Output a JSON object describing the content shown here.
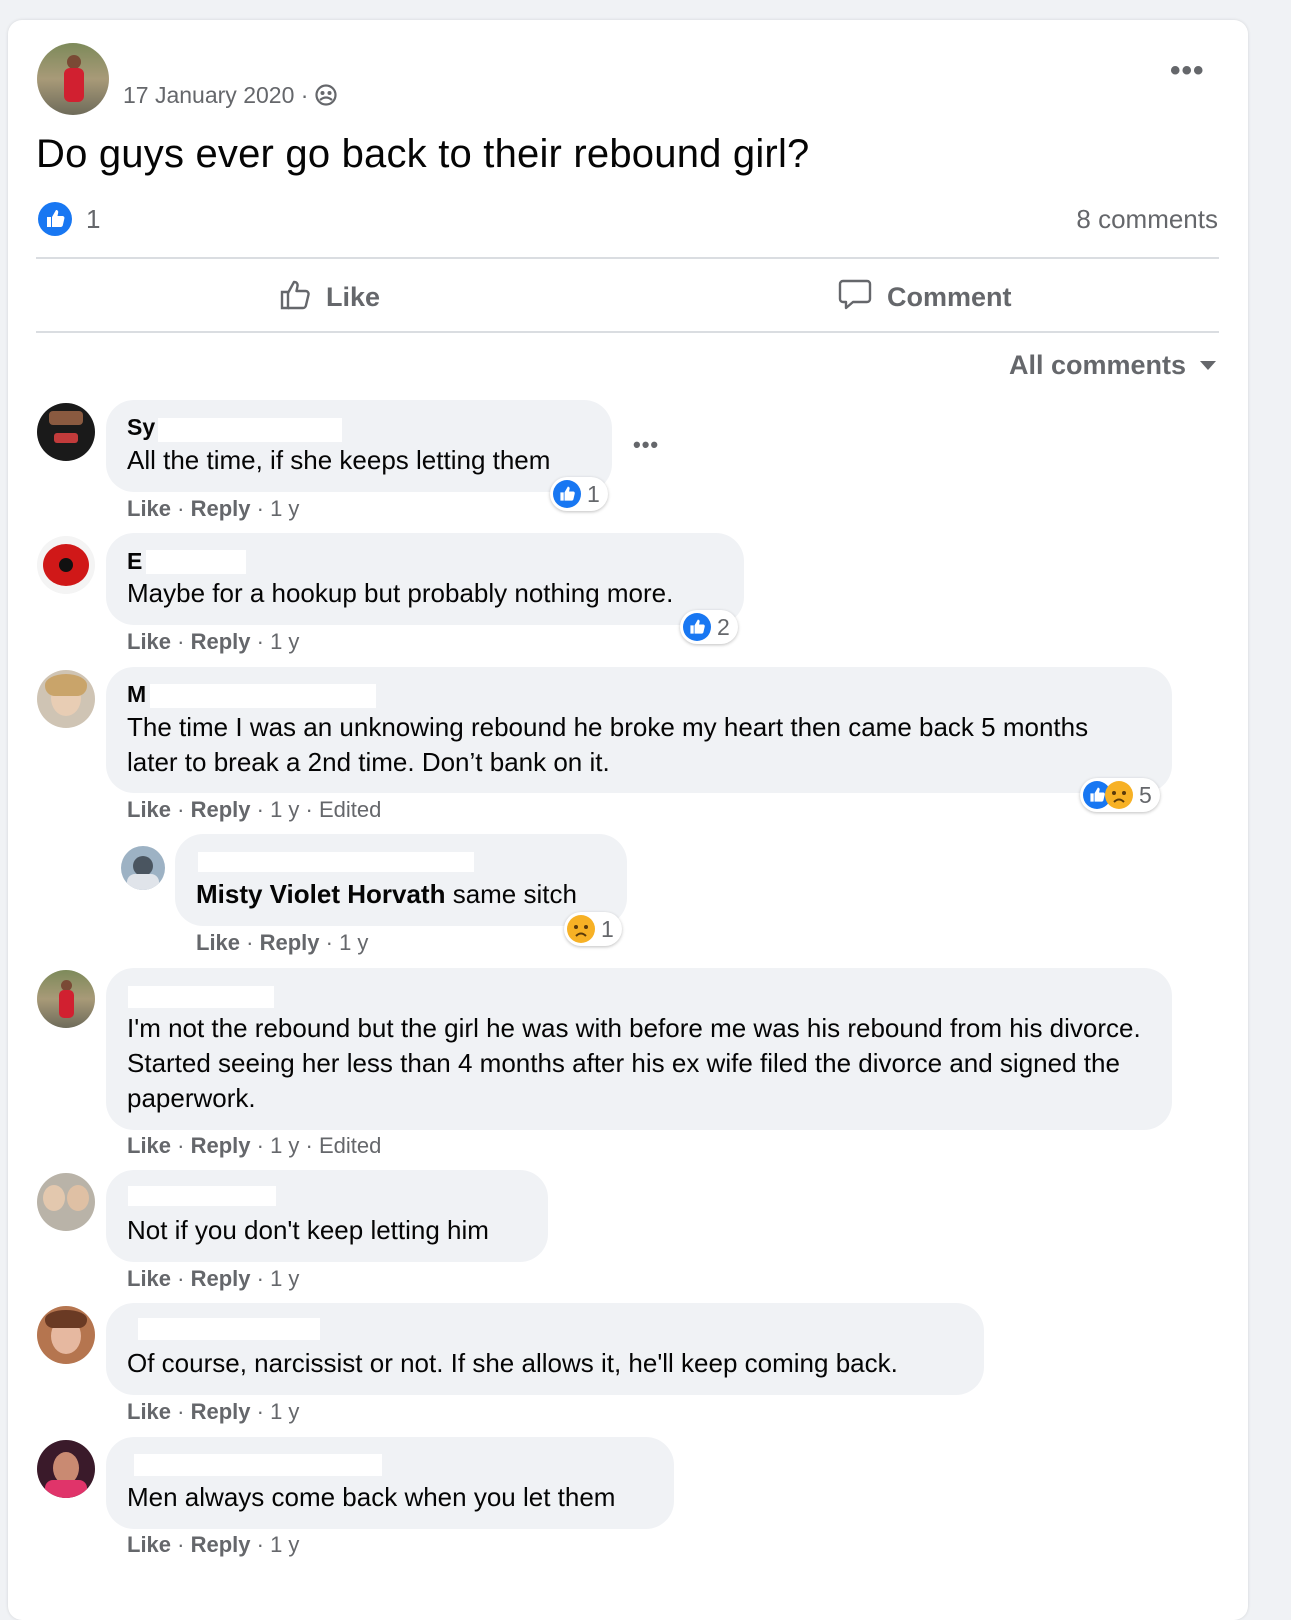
{
  "post": {
    "date": "17 January 2020",
    "dot": " · ",
    "title": "Do guys ever go back to their rebound girl?",
    "like_count": "1",
    "comment_count": "8 comments"
  },
  "actions": {
    "like": "Like",
    "comment": "Comment"
  },
  "filter": {
    "label": "All comments"
  },
  "comments": [
    {
      "name": "Sy",
      "text": "All the time, if she keeps letting them",
      "like": "Like",
      "reply": "Reply",
      "meta": " · 1 y",
      "reactions": "1"
    },
    {
      "name": "E",
      "text": "Maybe for a hookup but probably nothing more.",
      "like": "Like",
      "reply": "Reply",
      "meta": " · 1 y",
      "reactions": "2"
    },
    {
      "name": "M",
      "text": "The time I was an unknowing rebound he broke my heart then came back 5 months later to break a 2nd time. Don’t bank on it.",
      "like": "Like",
      "reply": "Reply",
      "meta": " · 1 y · Edited",
      "reactions": "5"
    },
    {
      "name": "",
      "mention": "Misty Violet Horvath",
      "text": " same sitch",
      "like": "Like",
      "reply": "Reply",
      "meta": " · 1 y",
      "reactions": "1"
    },
    {
      "name": "",
      "text": "I'm not the rebound but the girl he was with before me was his rebound from his divorce. Started seeing her less than 4 months after his ex wife filed the divorce and signed the paperwork.",
      "like": "Like",
      "reply": "Reply",
      "meta": " · 1 y · Edited"
    },
    {
      "name": "",
      "text": "Not if you don't keep letting him",
      "like": "Like",
      "reply": "Reply",
      "meta": " · 1 y"
    },
    {
      "name": "",
      "text": "Of course, narcissist or not. If she allows it, he'll keep coming back.",
      "like": "Like",
      "reply": "Reply",
      "meta": " · 1 y"
    },
    {
      "name": "",
      "text": "Men always come back when you let them",
      "like": "Like",
      "reply": "Reply",
      "meta": " · 1 y"
    }
  ],
  "colors": {
    "accent": "#1877f2",
    "bubble": "#f0f2f5",
    "muted": "#65676b"
  },
  "icons": {
    "like": "thumbs-up-icon",
    "comment": "speech-bubble-icon",
    "more": "more-icon",
    "privacy": "group-icon",
    "sad": "sad-face-icon",
    "dropdown": "caret-down-icon"
  }
}
